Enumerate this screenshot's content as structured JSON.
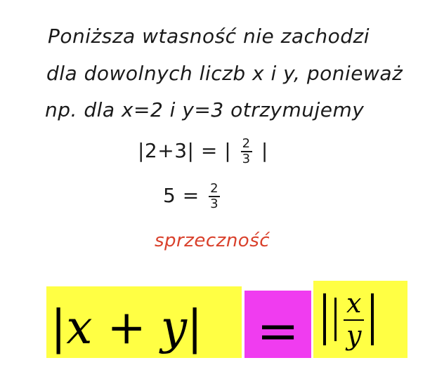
{
  "handwritten": {
    "line1": "Poniższa wtasność nie zachodzi",
    "line2": "dla dowolnych liczb x i y, ponieważ",
    "line3": "np. dla  x=2  i  y=3  otrzymujemy",
    "eq1": {
      "left": "|2+3| = |",
      "frac_num": "2",
      "frac_den": "3",
      "right": "|"
    },
    "eq2": {
      "left": "5  =",
      "frac_num": "2",
      "frac_den": "3"
    },
    "contradiction": "sprzeczność"
  },
  "formula": {
    "left_open": "|",
    "var_x": "x",
    "plus": " + ",
    "var_y": "y",
    "left_close": "|",
    "equals": "=",
    "frac_num": "x",
    "frac_den": "y"
  },
  "colors": {
    "highlight_yellow": "#ffff44",
    "highlight_magenta": "#f03cf0",
    "red_ink": "#d9402b"
  }
}
